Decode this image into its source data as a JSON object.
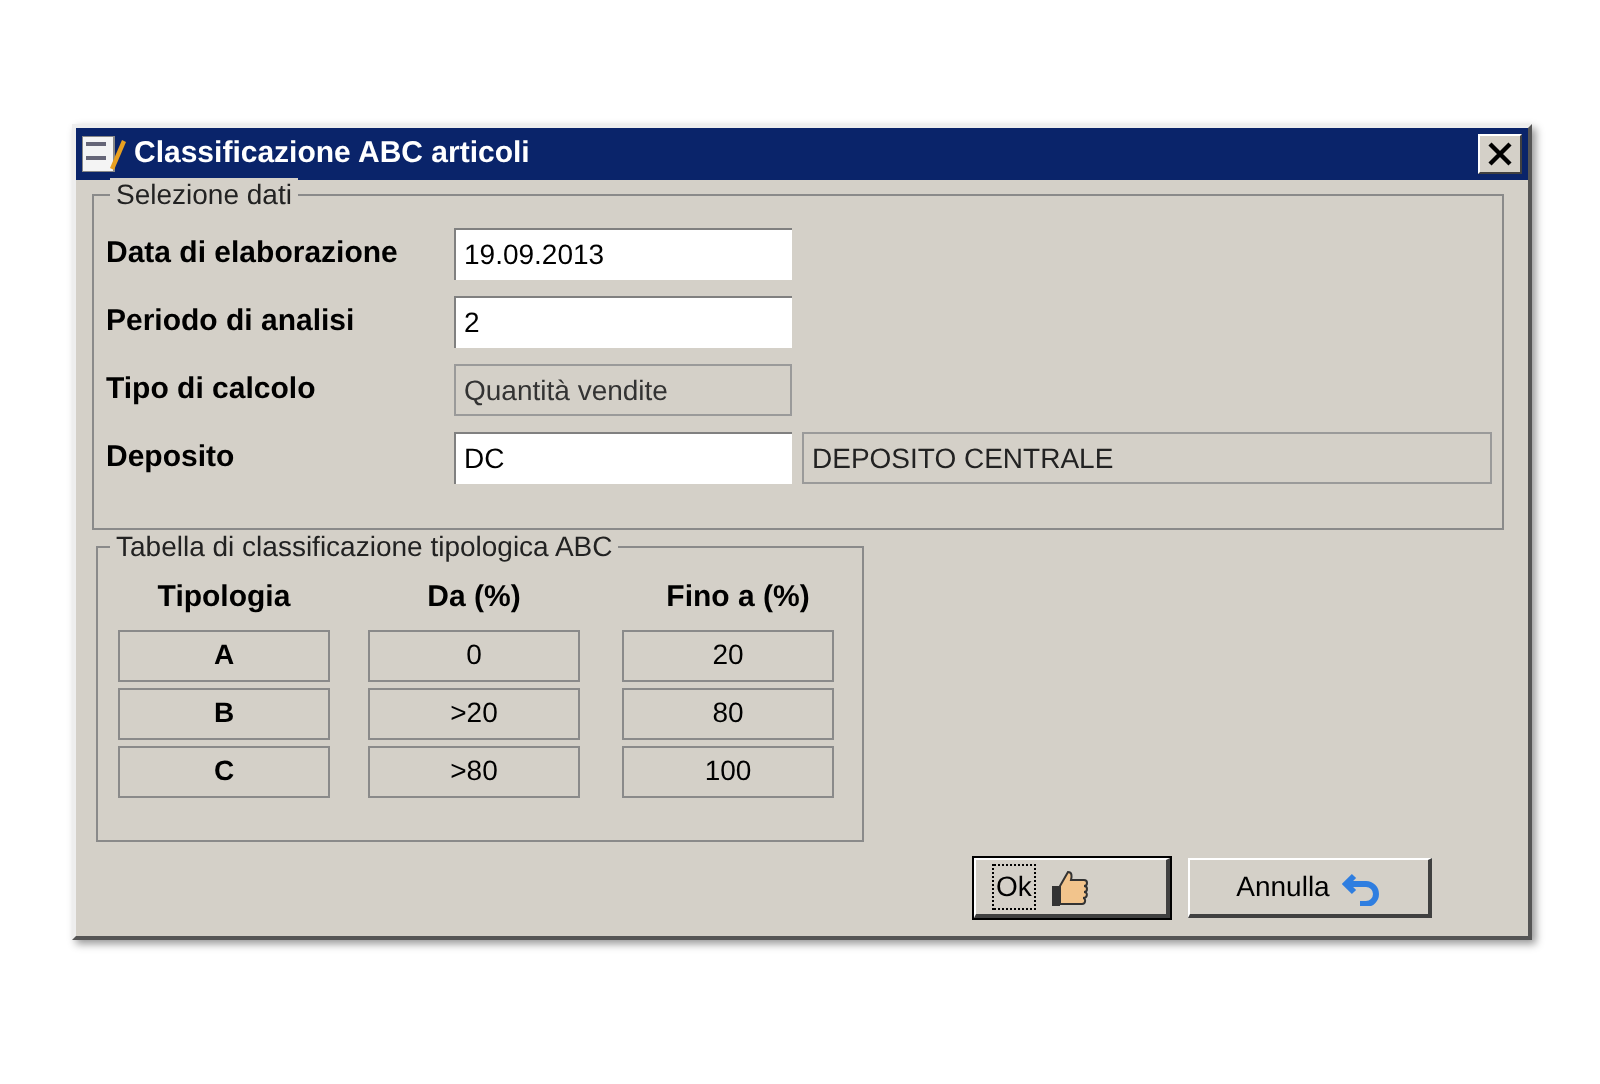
{
  "window": {
    "title": "Classificazione ABC articoli"
  },
  "selection": {
    "legend": "Selezione dati",
    "fields": [
      {
        "label": "Data di elaborazione",
        "value": "19.09.2013",
        "kind": "input"
      },
      {
        "label": "Periodo di analisi",
        "value": "2",
        "kind": "input"
      },
      {
        "label": "Tipo di calcolo",
        "value": "Quantità vendite",
        "kind": "readonly"
      },
      {
        "label": "Deposito",
        "value": "DC",
        "kind": "input",
        "description": "DEPOSITO CENTRALE"
      }
    ]
  },
  "classification": {
    "legend": "Tabella di classificazione tipologica ABC",
    "columns": [
      "Tipologia",
      "Da (%)",
      "Fino a (%)"
    ],
    "rows": [
      [
        "A",
        "0",
        "20"
      ],
      [
        "B",
        ">20",
        "80"
      ],
      [
        "C",
        ">80",
        "100"
      ]
    ]
  },
  "buttons": [
    {
      "label": "Ok",
      "kind": "ok",
      "focused": true
    },
    {
      "label": "Annulla",
      "kind": "cancel",
      "focused": false
    }
  ]
}
